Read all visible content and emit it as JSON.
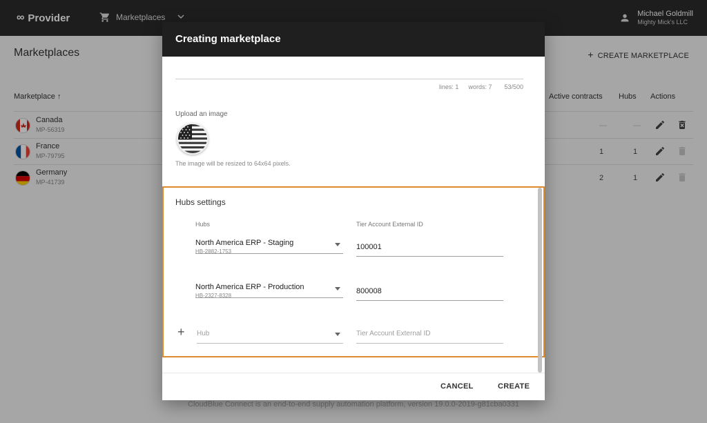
{
  "app": {
    "brand": "Provider",
    "brand_logo_glyph": "∞",
    "nav_label": "Marketplaces"
  },
  "user": {
    "name": "Michael Goldmill",
    "org": "Mighty Mick's LLC"
  },
  "page": {
    "title": "Marketplaces",
    "create_label": "CREATE MARKETPLACE",
    "footer_text": "CloudBlue Connect is an end-to-end supply automation platform, version 19.0.0-2019-g81cba0331"
  },
  "table": {
    "columns": {
      "marketplace": "Marketplace ↑",
      "active_contracts": "Active contracts",
      "hubs": "Hubs",
      "actions": "Actions"
    },
    "rows": [
      {
        "name": "Canada",
        "id": "MP-56319",
        "contracts": "—",
        "hubs": "—",
        "flag": "canada-flag-icon",
        "delete_enabled": true
      },
      {
        "name": "France",
        "id": "MP-79795",
        "contracts": "1",
        "hubs": "1",
        "flag": "france-flag-icon",
        "delete_enabled": false
      },
      {
        "name": "Germany",
        "id": "MP-41739",
        "contracts": "2",
        "hubs": "1",
        "flag": "germany-flag-icon",
        "delete_enabled": false
      }
    ]
  },
  "dialog": {
    "title": "Creating marketplace",
    "description_stats": {
      "lines": "lines: 1",
      "words": "words: 7",
      "count": "53/500"
    },
    "upload_label": "Upload an image",
    "upload_icon": "usa-flag-icon",
    "upload_hint": "The image will be resized to 64x64 pixels.",
    "hubs_settings": {
      "title": "Hubs settings",
      "col_hubs": "Hubs",
      "col_external_id": "Tier Account External ID",
      "entries": [
        {
          "hub_name": "North America ERP - Staging",
          "hub_id": "HB-2882-1753",
          "external_id": "100001"
        },
        {
          "hub_name": "North America ERP - Production",
          "hub_id": "HB-2327-8328",
          "external_id": "800008"
        }
      ],
      "new_hub_placeholder": "Hub",
      "new_external_id_placeholder": "Tier Account External ID"
    },
    "cancel_label": "CANCEL",
    "create_label": "CREATE"
  },
  "colors": {
    "accent_highlight": "#e08a2e",
    "topbar": "#2b2b2b",
    "dialog_header": "#1f1f1f"
  }
}
